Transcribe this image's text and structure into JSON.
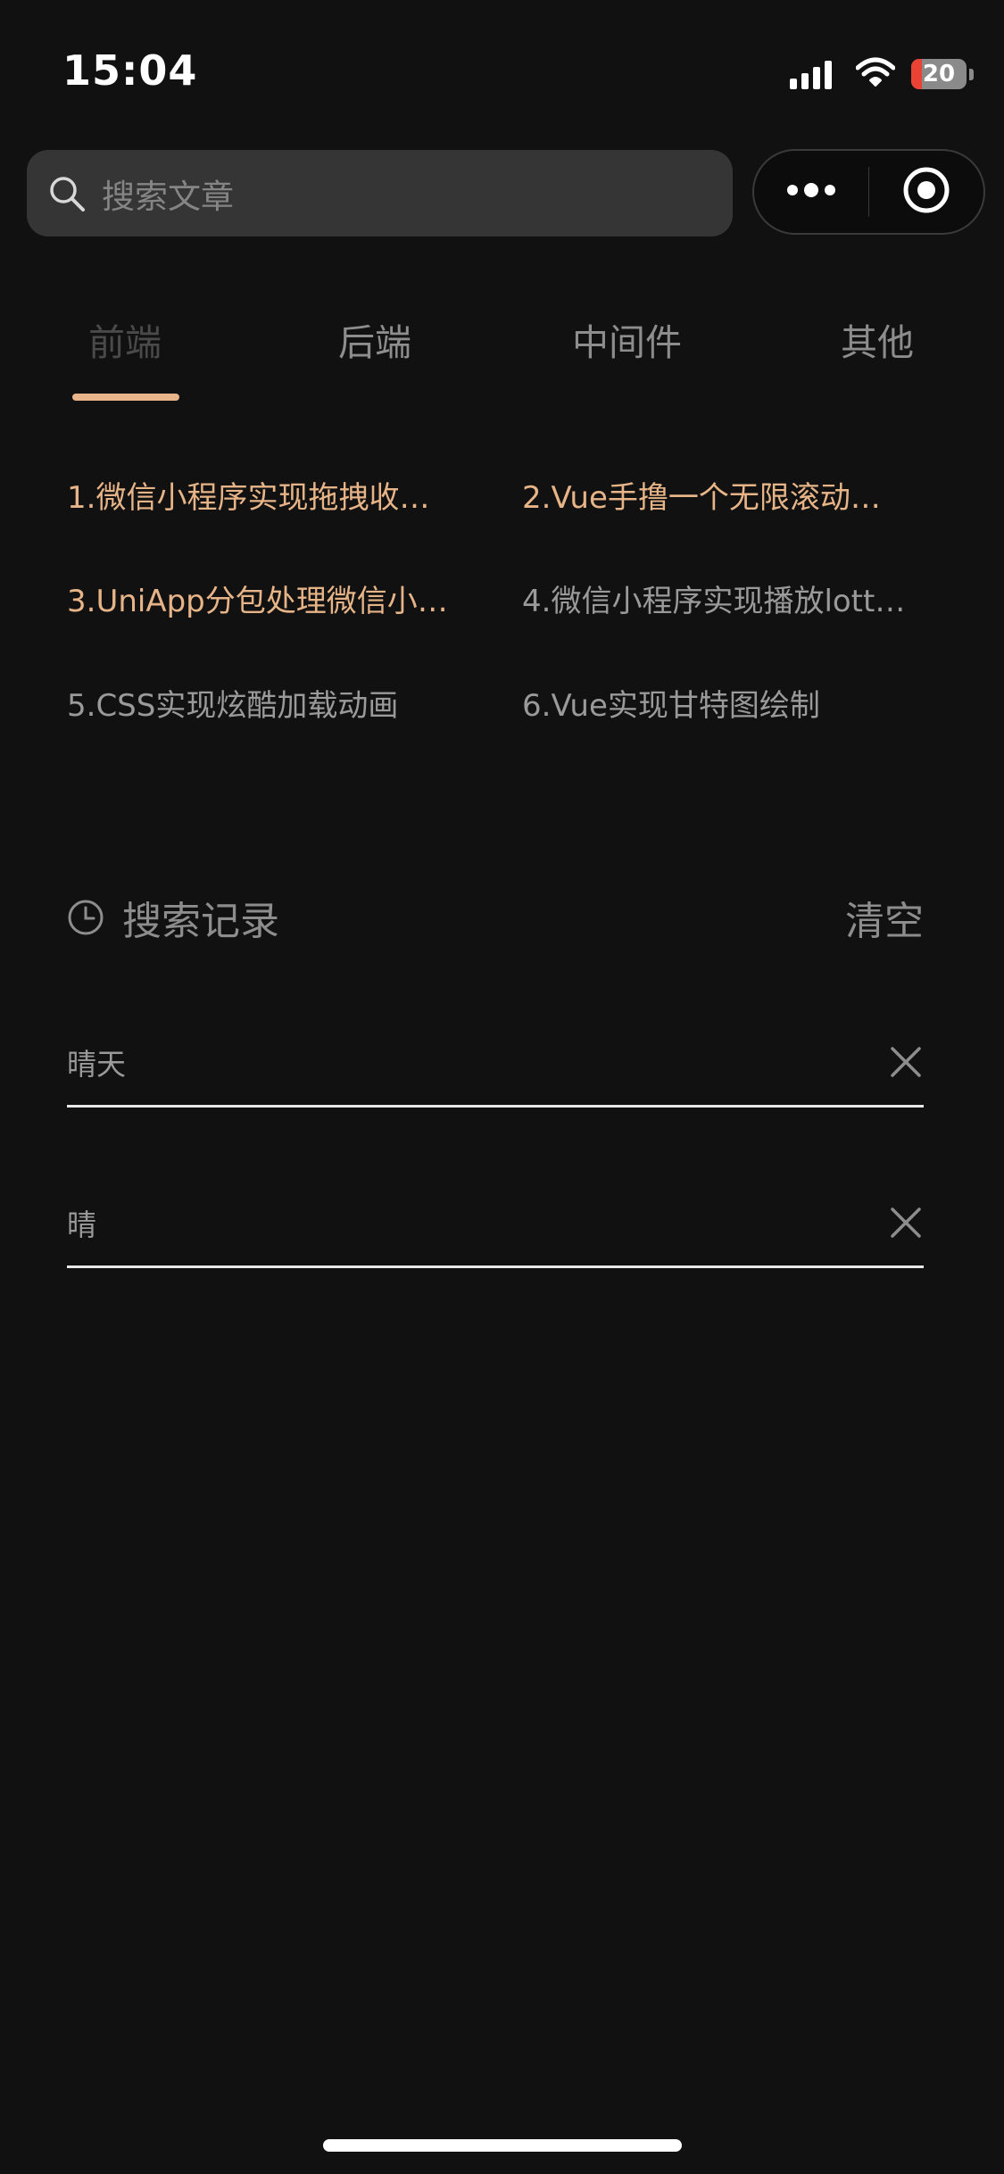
{
  "status_bar": {
    "time": "15:04",
    "battery_level": "20",
    "battery_fraction": 0.2,
    "battery_charging": true,
    "signal_icon": "signal-bars-icon",
    "wifi_icon": "wifi-icon"
  },
  "search": {
    "placeholder": "搜索文章",
    "icon": "search-icon"
  },
  "capsule": {
    "more_icon": "more-dots-icon",
    "close_icon": "mini-program-close-icon"
  },
  "tabs": [
    {
      "label": "前端",
      "active": true
    },
    {
      "label": "后端",
      "active": false
    },
    {
      "label": "中间件",
      "active": false
    },
    {
      "label": "其他",
      "active": false
    }
  ],
  "articles": [
    {
      "text": "1.微信小程序实现拖拽收…",
      "highlight": true
    },
    {
      "text": "2.Vue手撸一个无限滚动…",
      "highlight": true
    },
    {
      "text": "3.UniApp分包处理微信小…",
      "highlight": true
    },
    {
      "text": "4.微信小程序实现播放lott…",
      "highlight": false
    },
    {
      "text": "5.CSS实现炫酷加载动画",
      "highlight": false
    },
    {
      "text": "6.Vue实现甘特图绘制",
      "highlight": false
    }
  ],
  "history": {
    "title": "搜索记录",
    "clear_label": "清空",
    "icon": "clock-icon",
    "items": [
      {
        "text": "晴天"
      },
      {
        "text": "晴"
      }
    ]
  },
  "colors": {
    "background": "#111111",
    "accent": "#e6b487",
    "indicator": "#e8b58a",
    "muted_text": "#8d8d8d",
    "search_bg": "#353535"
  }
}
